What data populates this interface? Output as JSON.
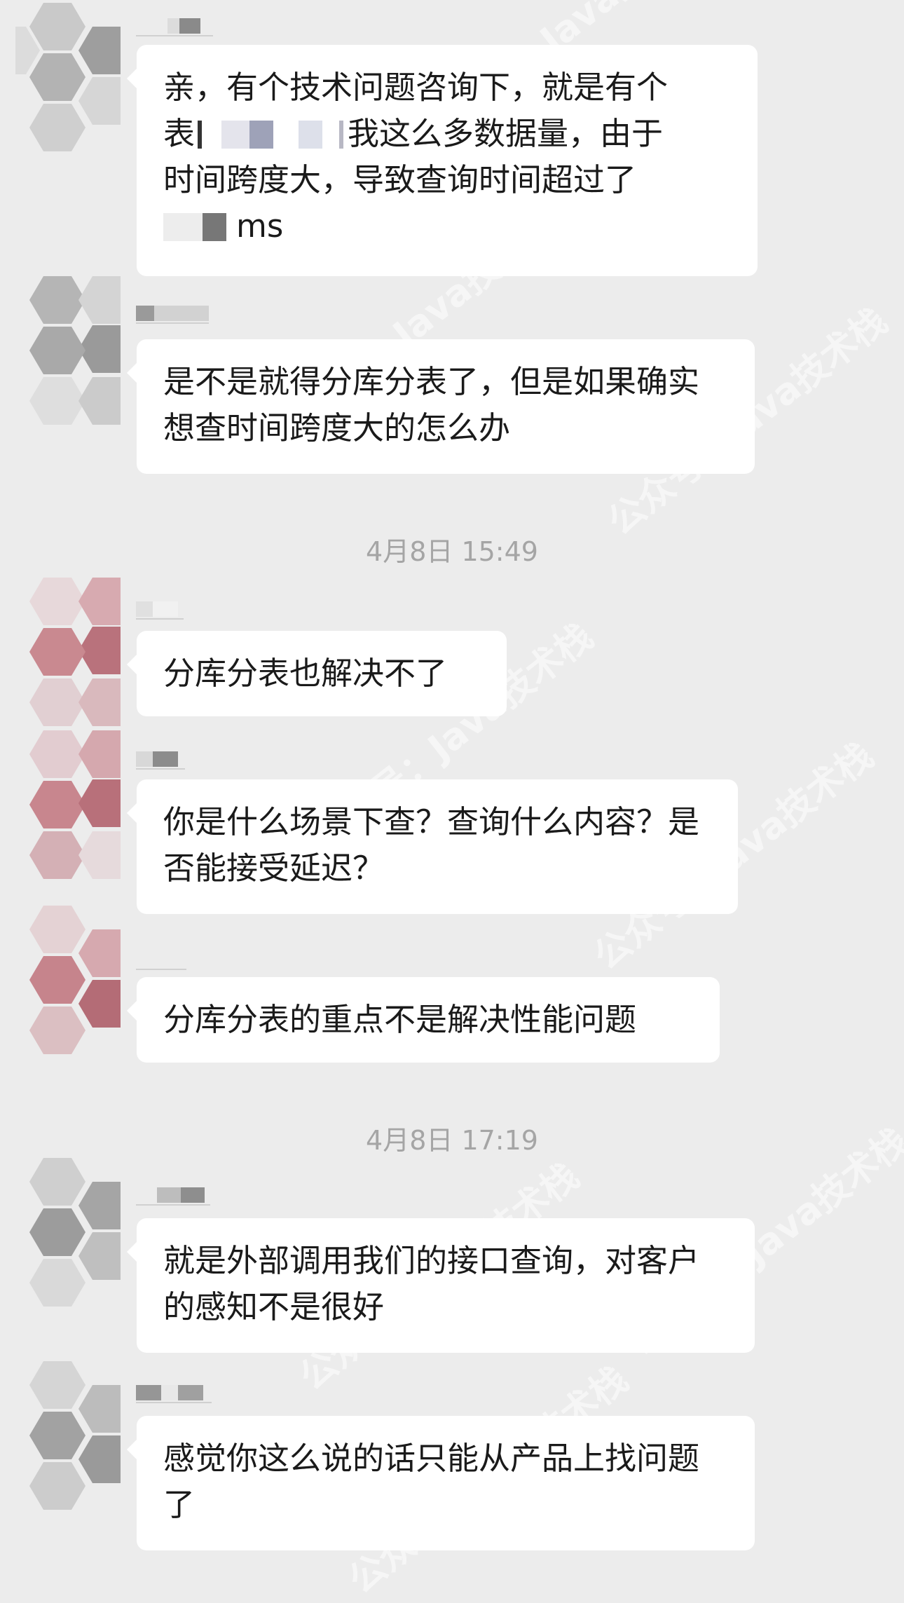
{
  "watermark_text": "公众号：Java技术栈",
  "messages": [
    {
      "id": "m1",
      "lines": [
        "亲，有个技术问题咨询下，就是有个",
        "我这么多数据量，由于",
        "时间跨度大，导致查询时间超过了",
        "ms"
      ],
      "line2_prefix": "表"
    },
    {
      "id": "m2",
      "text": "是不是就得分库分表了，但是如果确实想查时间跨度大的怎么办"
    },
    {
      "id": "m3",
      "text": "分库分表也解决不了"
    },
    {
      "id": "m4",
      "text": "你是什么场景下查？查询什么内容？是否能接受延迟？"
    },
    {
      "id": "m5",
      "text": "分库分表的重点不是解决性能问题"
    },
    {
      "id": "m6",
      "text": "就是外部调用我们的接口查询，对客户的感知不是很好"
    },
    {
      "id": "m7",
      "text": "感觉你这么说的话只能从产品上找问题了"
    }
  ],
  "timestamps": {
    "t1": "4月8日 15:49",
    "t2": "4月8日 17:19"
  },
  "colors": {
    "background": "#ececec",
    "bubble": "#ffffff",
    "timestamp": "#a5a5a5",
    "avatar_gray": "#a8a8a8",
    "avatar_pink": "#c98a90"
  }
}
